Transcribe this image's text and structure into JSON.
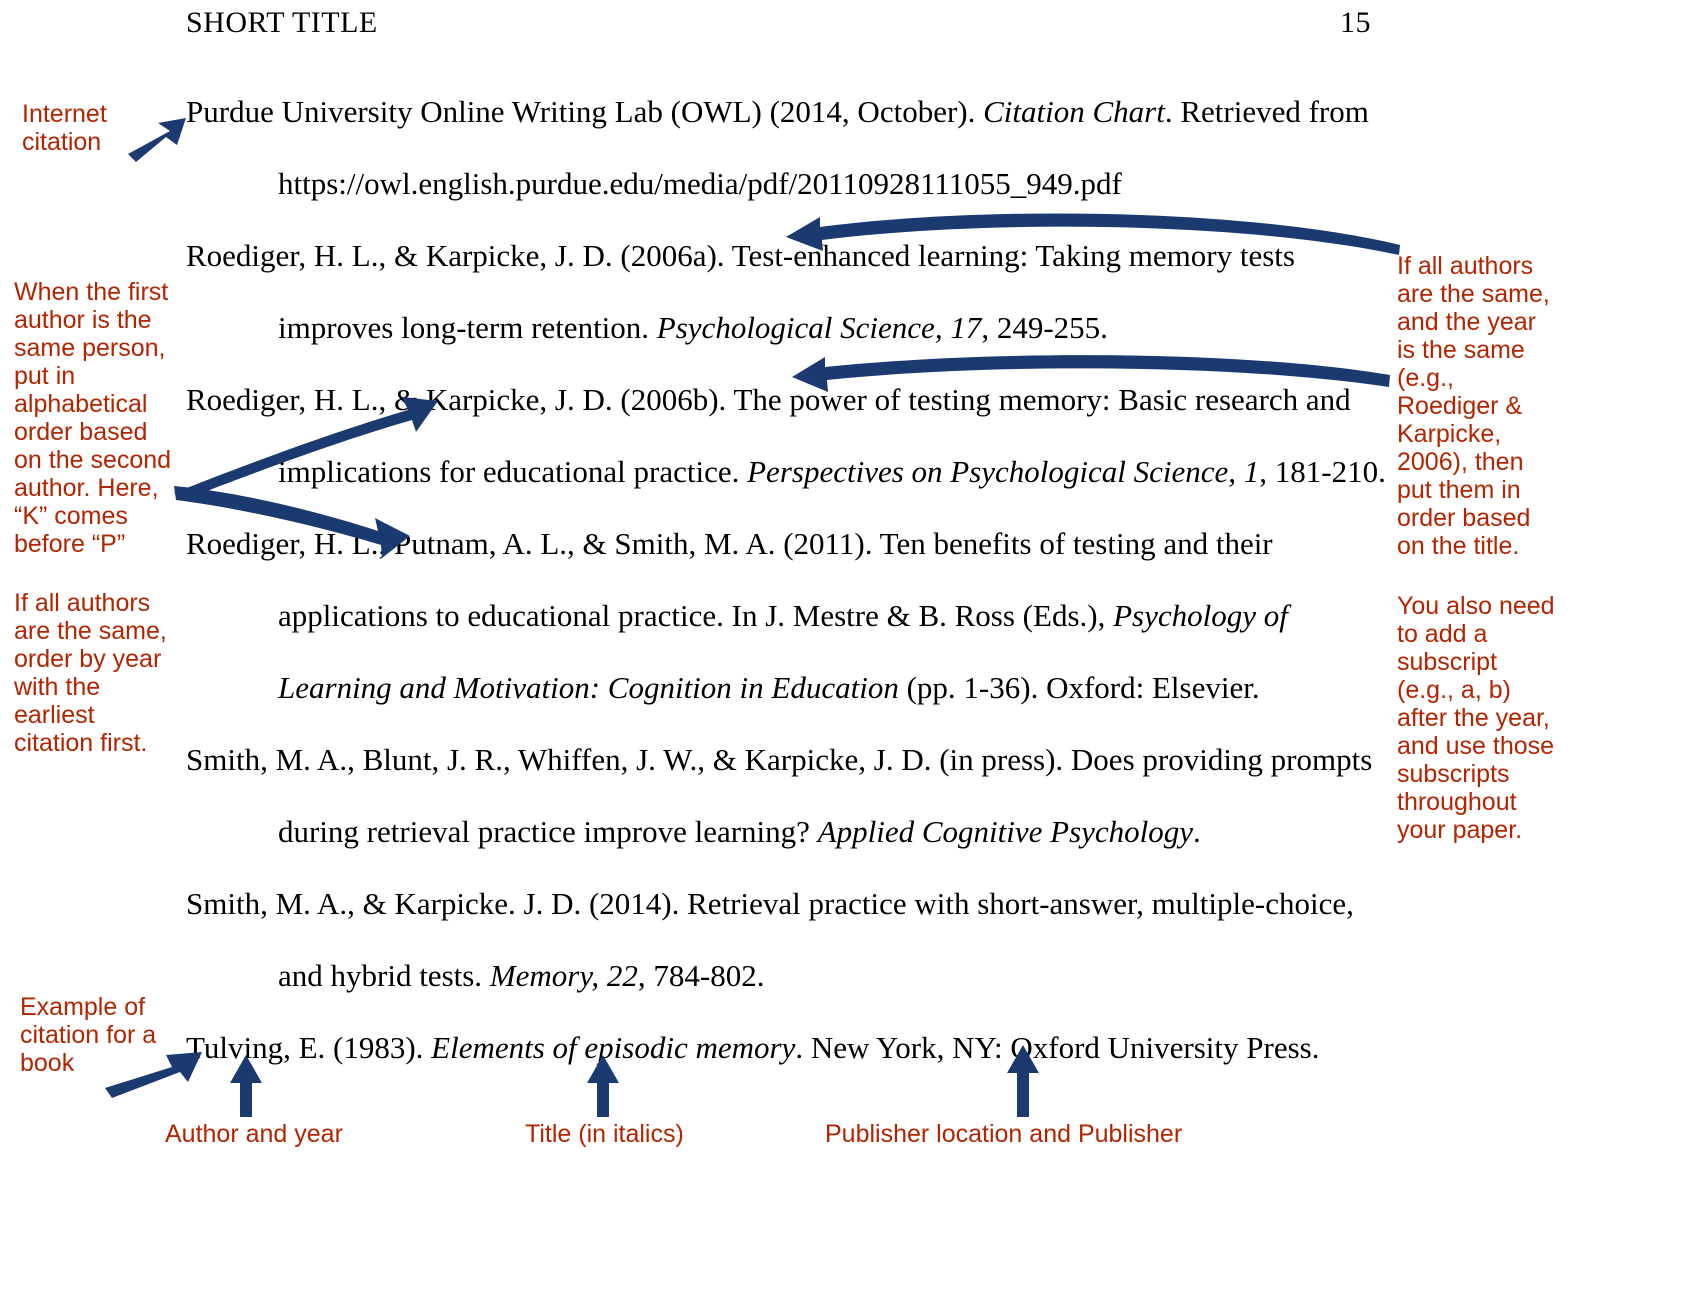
{
  "page": {
    "running_head": "SHORT TITLE",
    "page_number": "15",
    "accent_red": "#b32400",
    "accent_navy": "#1b3a70",
    "background": "#ffffff"
  },
  "references": [
    {
      "id": "owl",
      "lines": [
        [
          {
            "t": "Purdue University Online Writing Lab (OWL) (2014, October). ",
            "style": "normal"
          },
          {
            "t": "Citation Chart",
            "style": "italic"
          },
          {
            "t": ". Retrieved from",
            "style": "normal"
          }
        ],
        [
          {
            "t": "https://owl.english.purdue.edu/media/pdf/20110928111055_949.pdf",
            "style": "normal"
          }
        ]
      ]
    },
    {
      "id": "roediger-2006a",
      "lines": [
        [
          {
            "t": "Roediger, H. L., & Karpicke, J. D. (2006a). Test-enhanced learning: Taking memory tests",
            "style": "normal"
          }
        ],
        [
          {
            "t": "improves long-term retention. ",
            "style": "normal"
          },
          {
            "t": "Psychological Science, 17",
            "style": "italic"
          },
          {
            "t": ", 249-255.",
            "style": "normal"
          }
        ]
      ]
    },
    {
      "id": "roediger-2006b",
      "lines": [
        [
          {
            "t": "Roediger, H. L., & Karpicke, J. D. (2006b). The power of testing memory: Basic research and",
            "style": "normal"
          }
        ],
        [
          {
            "t": "implications for educational practice. ",
            "style": "normal"
          },
          {
            "t": "Perspectives on Psychological Science, 1",
            "style": "italic"
          },
          {
            "t": ", 181-210.",
            "style": "normal"
          }
        ]
      ]
    },
    {
      "id": "roediger-2011",
      "lines": [
        [
          {
            "t": "Roediger, H. L., Putnam, A. L., & Smith, M. A. (2011).  Ten benefits of testing and their",
            "style": "normal"
          }
        ],
        [
          {
            "t": "applications to educational practice. In J. Mestre & B. Ross (Eds.), ",
            "style": "normal"
          },
          {
            "t": "Psychology of",
            "style": "italic"
          }
        ],
        [
          {
            "t": "Learning and Motivation: Cognition in Education",
            "style": "italic"
          },
          {
            "t": " (pp. 1-36). Oxford: Elsevier.",
            "style": "normal"
          }
        ]
      ]
    },
    {
      "id": "smith-in-press",
      "lines": [
        [
          {
            "t": "Smith, M. A., Blunt, J. R., Whiffen, J. W., & Karpicke, J. D. (in press). Does providing prompts",
            "style": "normal"
          }
        ],
        [
          {
            "t": "during retrieval practice improve learning? ",
            "style": "normal"
          },
          {
            "t": "Applied Cognitive Psychology",
            "style": "italic"
          },
          {
            "t": ".",
            "style": "normal"
          }
        ]
      ]
    },
    {
      "id": "smith-2014",
      "lines": [
        [
          {
            "t": "Smith, M. A., & Karpicke. J. D. (2014). Retrieval practice with short-answer, multiple-choice,",
            "style": "normal"
          }
        ],
        [
          {
            "t": "and hybrid tests. ",
            "style": "normal"
          },
          {
            "t": "Memory, 22",
            "style": "italic"
          },
          {
            "t": ", 784-802.",
            "style": "normal"
          }
        ]
      ]
    },
    {
      "id": "tulving-1983",
      "lines": [
        [
          {
            "t": "Tulving, E. (1983). ",
            "style": "normal"
          },
          {
            "t": "Elements of episodic memory",
            "style": "italic"
          },
          {
            "t": ". New York, NY: Oxford University Press.",
            "style": "normal"
          }
        ]
      ]
    }
  ],
  "annotations": {
    "internet_citation": "Internet\ncitation",
    "first_author_same": "When the first\nauthor is the\nsame person,\nput in\nalphabetical\norder based\non the second\nauthor. Here,\n“K” comes\nbefore “P”",
    "all_authors_same_year": "If all authors\nare the same,\norder by year\nwith the\nearliest\ncitation first.",
    "all_authors_same_and_year": "If all authors\nare the same,\nand the year\nis the same\n(e.g.,\nRoediger &\nKarpicke,\n2006), then\nput them in\norder based\non the title.",
    "subscript_note": "You also need\nto add a\nsubscript\n(e.g., a, b)\nafter the year,\nand use those\nsubscripts\nthroughout\nyour paper.",
    "book_example": "Example of\ncitation for a\nbook",
    "author_and_year": "Author and year",
    "title_in_italics": "Title (in italics)",
    "publisher_location": "Publisher location and Publisher"
  }
}
